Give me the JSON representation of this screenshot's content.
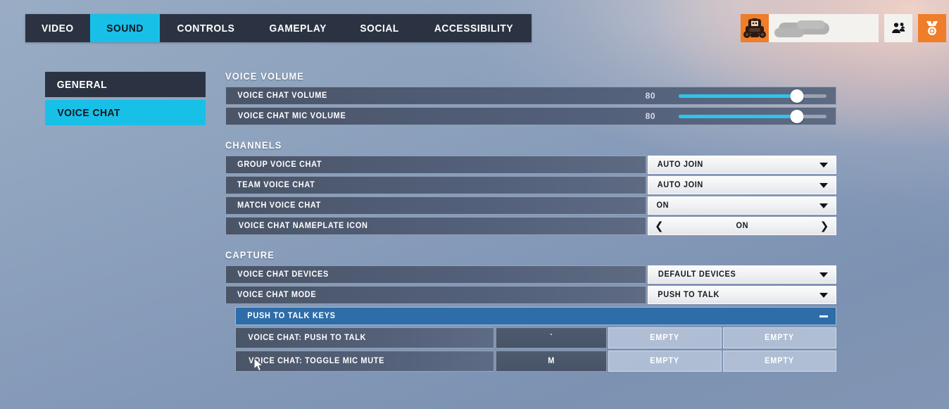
{
  "tabs": [
    {
      "label": "VIDEO",
      "active": false
    },
    {
      "label": "SOUND",
      "active": true
    },
    {
      "label": "CONTROLS",
      "active": false
    },
    {
      "label": "GAMEPLAY",
      "active": false
    },
    {
      "label": "SOCIAL",
      "active": false
    },
    {
      "label": "ACCESSIBILITY",
      "active": false
    }
  ],
  "account": {
    "avatar_icon": "hero-portrait-icon",
    "player_name": "",
    "social_icon": "add-friend-icon",
    "endorsement_icon": "endorsement-medal-icon"
  },
  "sidebar": {
    "items": [
      {
        "label": "GENERAL",
        "active": false
      },
      {
        "label": "VOICE CHAT",
        "active": true
      }
    ]
  },
  "sections": {
    "voice_volume": {
      "title": "VOICE VOLUME",
      "rows": [
        {
          "label": "VOICE CHAT VOLUME",
          "value": "80",
          "percent": 80
        },
        {
          "label": "VOICE CHAT MIC VOLUME",
          "value": "80",
          "percent": 80
        }
      ]
    },
    "channels": {
      "title": "CHANNELS",
      "rows": [
        {
          "label": "GROUP VOICE CHAT",
          "value": "AUTO JOIN",
          "type": "dropdown"
        },
        {
          "label": "TEAM VOICE CHAT",
          "value": "AUTO JOIN",
          "type": "dropdown"
        },
        {
          "label": "MATCH VOICE CHAT",
          "value": "ON",
          "type": "dropdown"
        },
        {
          "label": "VOICE CHAT NAMEPLATE ICON",
          "value": "ON",
          "type": "stepper"
        }
      ]
    },
    "capture": {
      "title": "CAPTURE",
      "rows": [
        {
          "label": "VOICE CHAT DEVICES",
          "value": "DEFAULT DEVICES",
          "type": "dropdown"
        },
        {
          "label": "VOICE CHAT MODE",
          "value": "PUSH TO TALK",
          "type": "dropdown"
        }
      ],
      "push_to_talk_keys": {
        "header": "PUSH TO TALK KEYS",
        "collapse_icon": "minus-icon",
        "bindings": [
          {
            "name": "VOICE CHAT: PUSH TO TALK",
            "key": "`",
            "slot2": "EMPTY",
            "slot3": "EMPTY"
          },
          {
            "name": "VOICE CHAT: TOGGLE MIC MUTE",
            "key": "M",
            "slot2": "EMPTY",
            "slot3": "EMPTY"
          }
        ]
      }
    }
  },
  "colors": {
    "accent_cyan": "#18c0e8",
    "accent_orange": "#ef7d29",
    "header_blue": "#2e6da8",
    "panel_dark": "#2b3342"
  }
}
